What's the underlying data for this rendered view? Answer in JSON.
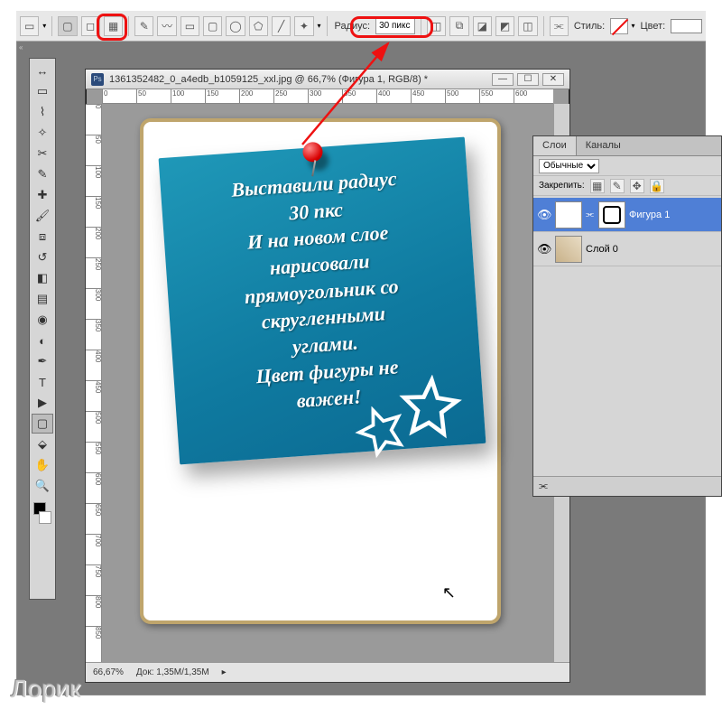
{
  "optbar": {
    "radius_label": "Радиус:",
    "radius_value": "30 пикс",
    "style_label": "Стиль:",
    "color_label": "Цвет:"
  },
  "document": {
    "title": "1361352482_0_a4edb_b1059125_xxl.jpg @ 66,7% (Фигура 1, RGB/8) *",
    "zoom": "66,67%",
    "doc_size": "Док: 1,35M/1,35M",
    "ruler_ticks": [
      "0",
      "50",
      "100",
      "150",
      "200",
      "250",
      "300",
      "350",
      "400",
      "450",
      "500",
      "550",
      "600"
    ],
    "ruler_v_ticks": [
      "0",
      "50",
      "100",
      "150",
      "200",
      "250",
      "300",
      "350",
      "400",
      "450",
      "500",
      "550",
      "600",
      "650",
      "700",
      "750",
      "800",
      "850"
    ]
  },
  "note_text": "Выставили радиус\n30 пкс\nИ на новом слое\nнарисовали\nпрямоугольник со\nскругленными\nуглами.\nЦвет фигуры не\nважен!",
  "panel": {
    "tab_layers": "Слои",
    "tab_channels": "Каналы",
    "blend_mode": "Обычные",
    "lock_label": "Закрепить:",
    "layer1_name": "Фигура 1",
    "layer0_name": "Слой 0"
  },
  "watermark": "Лорик"
}
